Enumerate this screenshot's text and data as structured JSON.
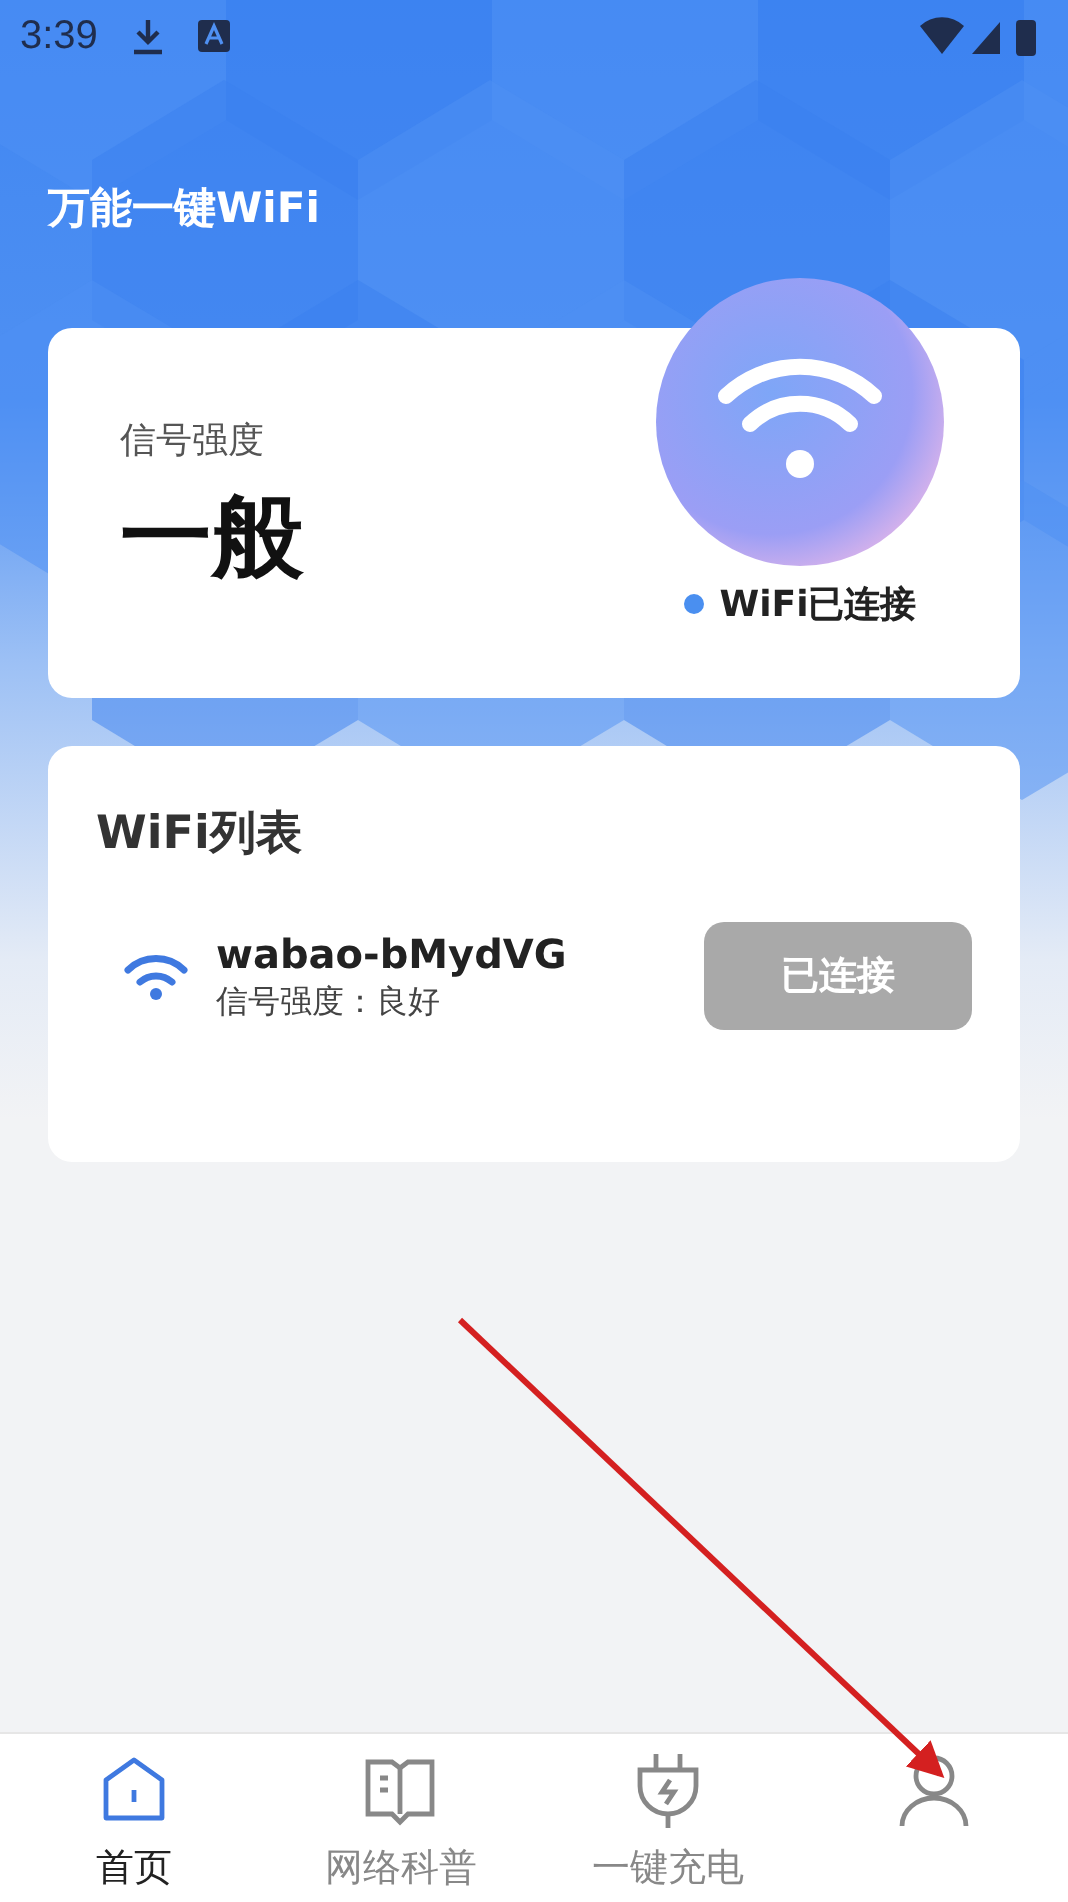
{
  "status_bar": {
    "time": "3:39"
  },
  "app_title": "万能一键WiFi",
  "signal_card": {
    "label": "信号强度",
    "value": "一般",
    "status": "WiFi已连接"
  },
  "wifi_list": {
    "title": "WiFi列表",
    "networks": [
      {
        "name": "wabao-bMydVG",
        "detail": "信号强度：良好",
        "button": "已连接",
        "connected": true
      }
    ]
  },
  "tabs": [
    {
      "label": "首页",
      "kind": "home",
      "selected": true
    },
    {
      "label": "网络科普",
      "kind": "book",
      "selected": false
    },
    {
      "label": "一键充电",
      "kind": "plug",
      "selected": false
    },
    {
      "kind": "user",
      "selected": false
    }
  ]
}
